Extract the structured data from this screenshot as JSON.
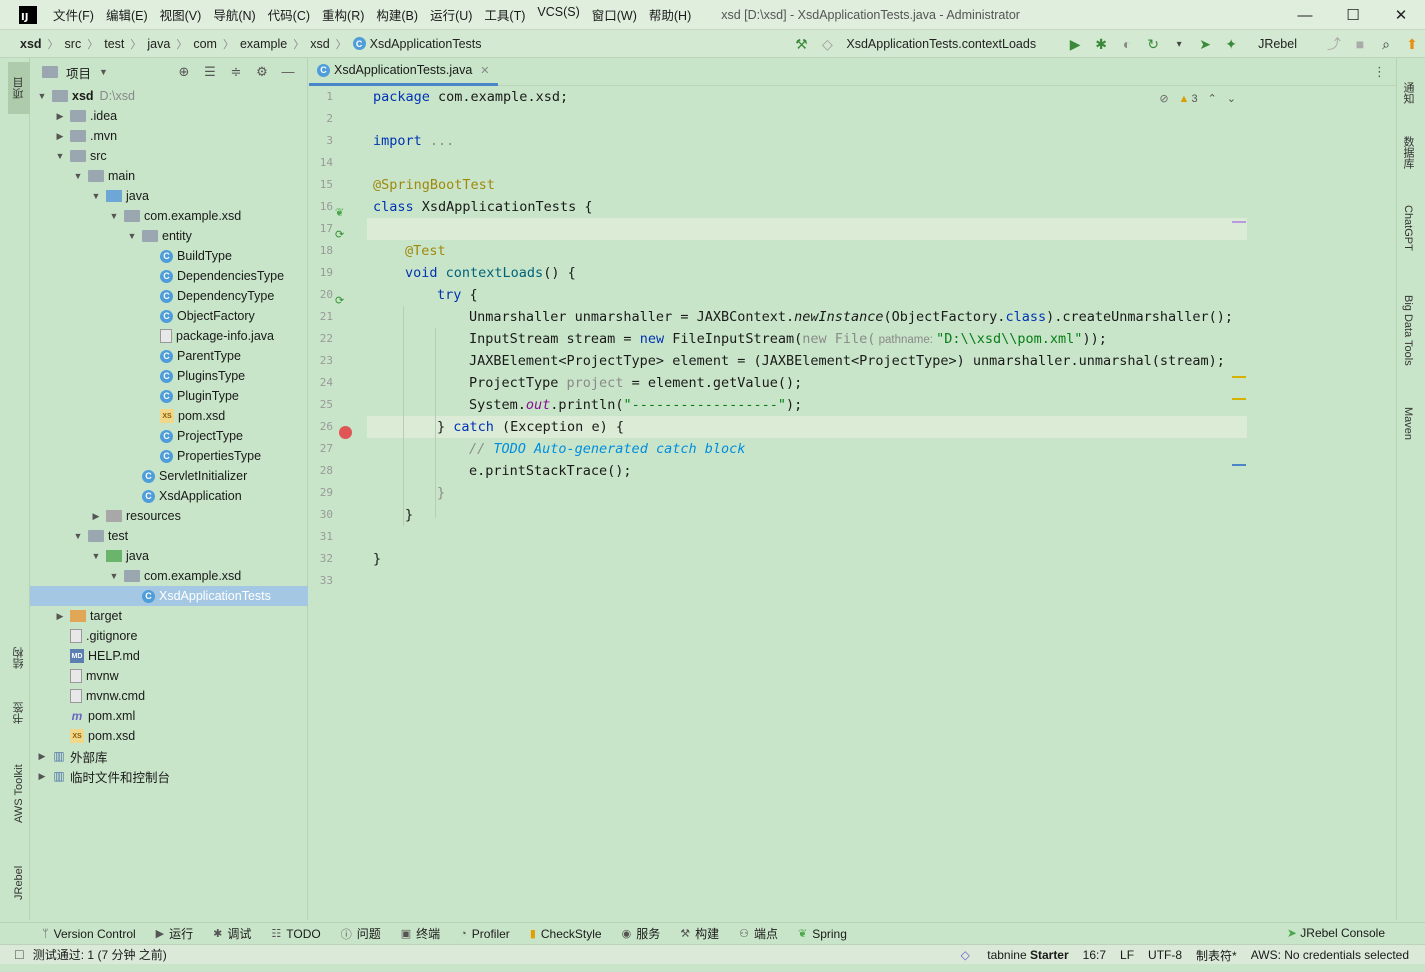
{
  "window": {
    "title": "xsd [D:\\xsd] - XsdApplicationTests.java - Administrator",
    "menu": [
      "文件(F)",
      "编辑(E)",
      "视图(V)",
      "导航(N)",
      "代码(C)",
      "重构(R)",
      "构建(B)",
      "运行(U)",
      "工具(T)",
      "VCS(S)",
      "窗口(W)",
      "帮助(H)"
    ],
    "controls": {
      "minimize": "—",
      "maximize": "☐",
      "close": "✕"
    },
    "logo_text": "IJ"
  },
  "navbar": {
    "breadcrumbs": [
      "xsd",
      "src",
      "test",
      "java",
      "com",
      "example",
      "xsd",
      "XsdApplicationTests"
    ],
    "run_config": "XsdApplicationTests.contextLoads",
    "jrebel": "JRebel"
  },
  "left_stripe": {
    "project": "项目",
    "structure": "结构",
    "bookmarks": "书签",
    "aws": "AWS Toolkit",
    "jrebel": "JRebel"
  },
  "right_stripe": [
    "通知",
    "数据库",
    "ChatGPT",
    "Big Data Tools",
    "Maven"
  ],
  "project_panel": {
    "title": "项目",
    "tree": [
      {
        "label": "xsd",
        "hint": "D:\\xsd",
        "icon": "folder",
        "depth": 0,
        "expanded": true,
        "bold": true
      },
      {
        "label": ".idea",
        "icon": "folder",
        "depth": 1,
        "expanded": false
      },
      {
        "label": ".mvn",
        "icon": "folder",
        "depth": 1,
        "expanded": false
      },
      {
        "label": "src",
        "icon": "folder",
        "depth": 1,
        "expanded": true
      },
      {
        "label": "main",
        "icon": "folder",
        "depth": 2,
        "expanded": true
      },
      {
        "label": "java",
        "icon": "folder-src",
        "depth": 3,
        "expanded": true
      },
      {
        "label": "com.example.xsd",
        "icon": "folder",
        "depth": 4,
        "expanded": true
      },
      {
        "label": "entity",
        "icon": "folder",
        "depth": 5,
        "expanded": true
      },
      {
        "label": "BuildType",
        "icon": "class",
        "depth": 6
      },
      {
        "label": "DependenciesType",
        "icon": "class",
        "depth": 6
      },
      {
        "label": "DependencyType",
        "icon": "class",
        "depth": 6
      },
      {
        "label": "ObjectFactory",
        "icon": "class",
        "depth": 6
      },
      {
        "label": "package-info.java",
        "icon": "file",
        "depth": 6
      },
      {
        "label": "ParentType",
        "icon": "class",
        "depth": 6
      },
      {
        "label": "PluginsType",
        "icon": "class",
        "depth": 6
      },
      {
        "label": "PluginType",
        "icon": "class",
        "depth": 6
      },
      {
        "label": "pom.xsd",
        "icon": "xsd",
        "depth": 6
      },
      {
        "label": "ProjectType",
        "icon": "class",
        "depth": 6
      },
      {
        "label": "PropertiesType",
        "icon": "class",
        "depth": 6
      },
      {
        "label": "ServletInitializer",
        "icon": "class",
        "depth": 5
      },
      {
        "label": "XsdApplication",
        "icon": "class",
        "depth": 5
      },
      {
        "label": "resources",
        "icon": "folder-res",
        "depth": 3,
        "expanded": false
      },
      {
        "label": "test",
        "icon": "folder",
        "depth": 2,
        "expanded": true
      },
      {
        "label": "java",
        "icon": "folder-test",
        "depth": 3,
        "expanded": true
      },
      {
        "label": "com.example.xsd",
        "icon": "folder",
        "depth": 4,
        "expanded": true
      },
      {
        "label": "XsdApplicationTests",
        "icon": "class",
        "depth": 5,
        "selected": true
      },
      {
        "label": "target",
        "icon": "folder-tgt",
        "depth": 1,
        "expanded": false
      },
      {
        "label": ".gitignore",
        "icon": "file",
        "depth": 1
      },
      {
        "label": "HELP.md",
        "icon": "md",
        "depth": 1
      },
      {
        "label": "mvnw",
        "icon": "file",
        "depth": 1
      },
      {
        "label": "mvnw.cmd",
        "icon": "file",
        "depth": 1
      },
      {
        "label": "pom.xml",
        "icon": "maven",
        "depth": 1
      },
      {
        "label": "pom.xsd",
        "icon": "xsd",
        "depth": 1
      },
      {
        "label": "外部库",
        "icon": "lib",
        "depth": 0,
        "expanded": false
      },
      {
        "label": "临时文件和控制台",
        "icon": "lib",
        "depth": 0,
        "expanded": false
      }
    ]
  },
  "editor": {
    "tab": "XsdApplicationTests.java",
    "warnings": "3",
    "line_numbers": [
      "1",
      "2",
      "3",
      "14",
      "15",
      "16",
      "17",
      "18",
      "19",
      "20",
      "21",
      "22",
      "23",
      "24",
      "25",
      "26",
      "27",
      "28",
      "29",
      "30",
      "31",
      "32",
      "33"
    ],
    "code": {
      "l1_kw": "package",
      "l1_rest": " com.example.xsd;",
      "l3_kw": "import",
      "l3_rest": " ...",
      "l15": "@SpringBootTest",
      "l16_kw": "class",
      "l16_rest": " XsdApplicationTests {",
      "l18": "@Test",
      "l19_kw": "void",
      "l19_fn": " contextLoads",
      "l19_rest": "() {",
      "l20_kw": "try",
      "l20_rest": " {",
      "l21_a": "Unmarshaller unmarshaller = JAXBContext.",
      "l21_it": "newInstance",
      "l21_b": "(ObjectFactory.",
      "l21_kw": "class",
      "l21_c": ").createUnmarshaller();",
      "l22_a": "InputStream stream = ",
      "l22_kw": "new",
      "l22_b": " FileInputStream(",
      "l22_g": "new File(",
      "l22_hint": " pathname: ",
      "l22_str": "\"D:\\\\xsd\\\\pom.xml\"",
      "l22_c": "));",
      "l23": "JAXBElement<ProjectType> element = (JAXBElement<ProjectType>) unmarshaller.unmarshal(stream);",
      "l24_a": "ProjectType ",
      "l24_g": "project",
      "l24_b": " = element.getValue();",
      "l25_a": "System.",
      "l25_f": "out",
      "l25_b": ".println(",
      "l25_str": "\"------------------\"",
      "l25_c": ");",
      "l26_a": "} ",
      "l26_kw": "catch",
      "l26_b": " (Exception e) {",
      "l27_cm": "// ",
      "l27_todo": "TODO Auto-generated catch block",
      "l28": "e.printStackTrace();",
      "l29": "}",
      "l30": "}",
      "l32": "}"
    }
  },
  "bottom_tools": [
    "Version Control",
    "运行",
    "调试",
    "TODO",
    "问题",
    "终端",
    "Profiler",
    "CheckStyle",
    "服务",
    "构建",
    "端点",
    "Spring"
  ],
  "jrebel_console": "JRebel Console",
  "status": {
    "message": "测试通过: 1 (7 分钟 之前)",
    "tabnine_a": "tabnine",
    "tabnine_b": "Starter",
    "position": "16:7",
    "line_sep": "LF",
    "encoding": "UTF-8",
    "indent": "制表符*",
    "aws": "AWS: No credentials selected"
  },
  "colors": {
    "background": "#c9e5c9",
    "keyword": "#0033b3",
    "annotation": "#9e880d",
    "string": "#067d17",
    "selection": "#a4c7e4",
    "breakpoint": "#e05555"
  }
}
